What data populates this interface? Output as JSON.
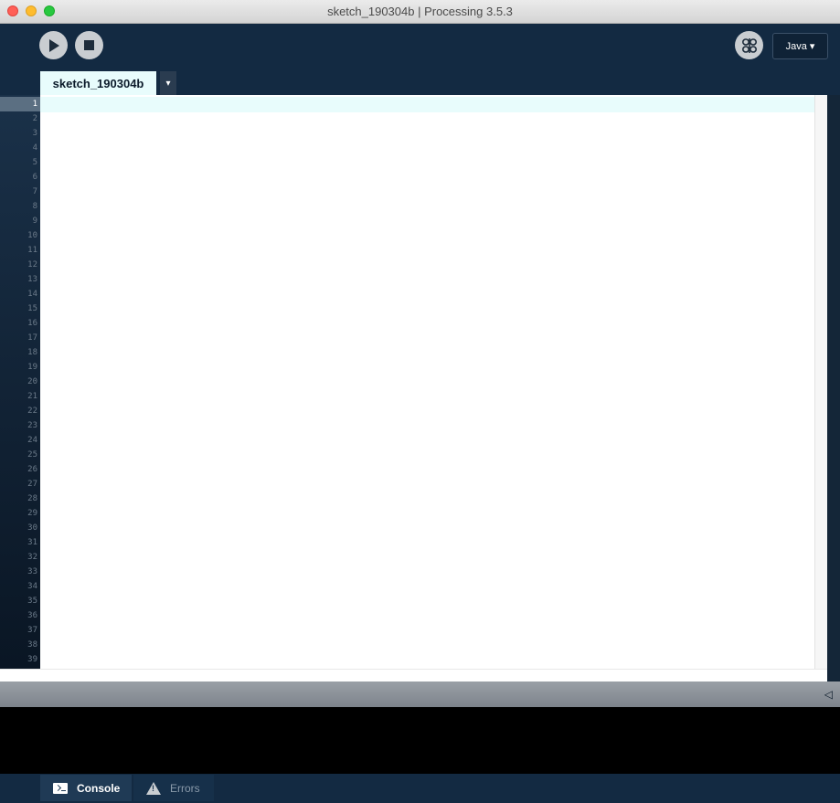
{
  "window": {
    "title": "sketch_190304b | Processing 3.5.3"
  },
  "toolbar": {
    "run_icon": "play-icon",
    "stop_icon": "stop-icon",
    "debug_icon": "butterfly-debug-icon",
    "mode_label": "Java ▾"
  },
  "tabs": [
    {
      "label": "sketch_190304b",
      "active": true
    }
  ],
  "tab_menu_label": "▾",
  "editor": {
    "current_line": 1,
    "line_numbers": [
      "1",
      "2",
      "3",
      "4",
      "5",
      "6",
      "7",
      "8",
      "9",
      "10",
      "11",
      "12",
      "13",
      "14",
      "15",
      "16",
      "17",
      "18",
      "19",
      "20",
      "21",
      "22",
      "23",
      "24",
      "25",
      "26",
      "27",
      "28",
      "29",
      "30",
      "31",
      "32",
      "33",
      "34",
      "35",
      "36",
      "37",
      "38",
      "39"
    ],
    "content": ""
  },
  "message_bar": {
    "collapse_symbol": "◁"
  },
  "bottom_tabs": [
    {
      "label": "Console",
      "icon": "terminal-icon",
      "active": true
    },
    {
      "label": "Errors",
      "icon": "warning-icon",
      "active": false
    }
  ],
  "colors": {
    "background": "#132a42",
    "current_line_highlight": "#e8fcfc",
    "console_background": "#000000"
  }
}
